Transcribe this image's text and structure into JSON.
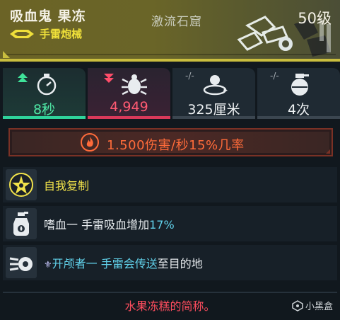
{
  "header": {
    "title": "吸血鬼 果冻",
    "subtitle": "手雷炮械",
    "location": "激流石窟",
    "level": "50级"
  },
  "stats": [
    {
      "value": "8秒",
      "indicator": "up",
      "icon": "stopwatch-icon"
    },
    {
      "value": "4,949",
      "indicator": "down",
      "icon": "bug-damage-icon"
    },
    {
      "value": "325厘米",
      "indicator": "-/-",
      "icon": "radius-icon"
    },
    {
      "value": "4次",
      "indicator": "-/-",
      "icon": "grenade-count-icon"
    }
  ],
  "damage": {
    "text": "1.500伤害/秒15%几率"
  },
  "perks": [
    {
      "text": "自我复制"
    },
    {
      "prefix": "嗜血一 手雷吸血增加",
      "suffix": "17%"
    },
    {
      "prefix": "开颅者一 手雷会传送",
      "suffix": "至目的地"
    }
  ],
  "footer": {
    "text": "水果冻糕的简称。"
  },
  "watermark": {
    "text": "小黑盒"
  },
  "colors": {
    "header_bg": "#6b6326",
    "accent_yellow": "#efe03a",
    "positive": "#4fe8a6",
    "negative": "#ff5a72",
    "damage": "#ff6b3a",
    "perk_cyan": "#61d1ea",
    "footer_red": "#ff4d5e"
  }
}
